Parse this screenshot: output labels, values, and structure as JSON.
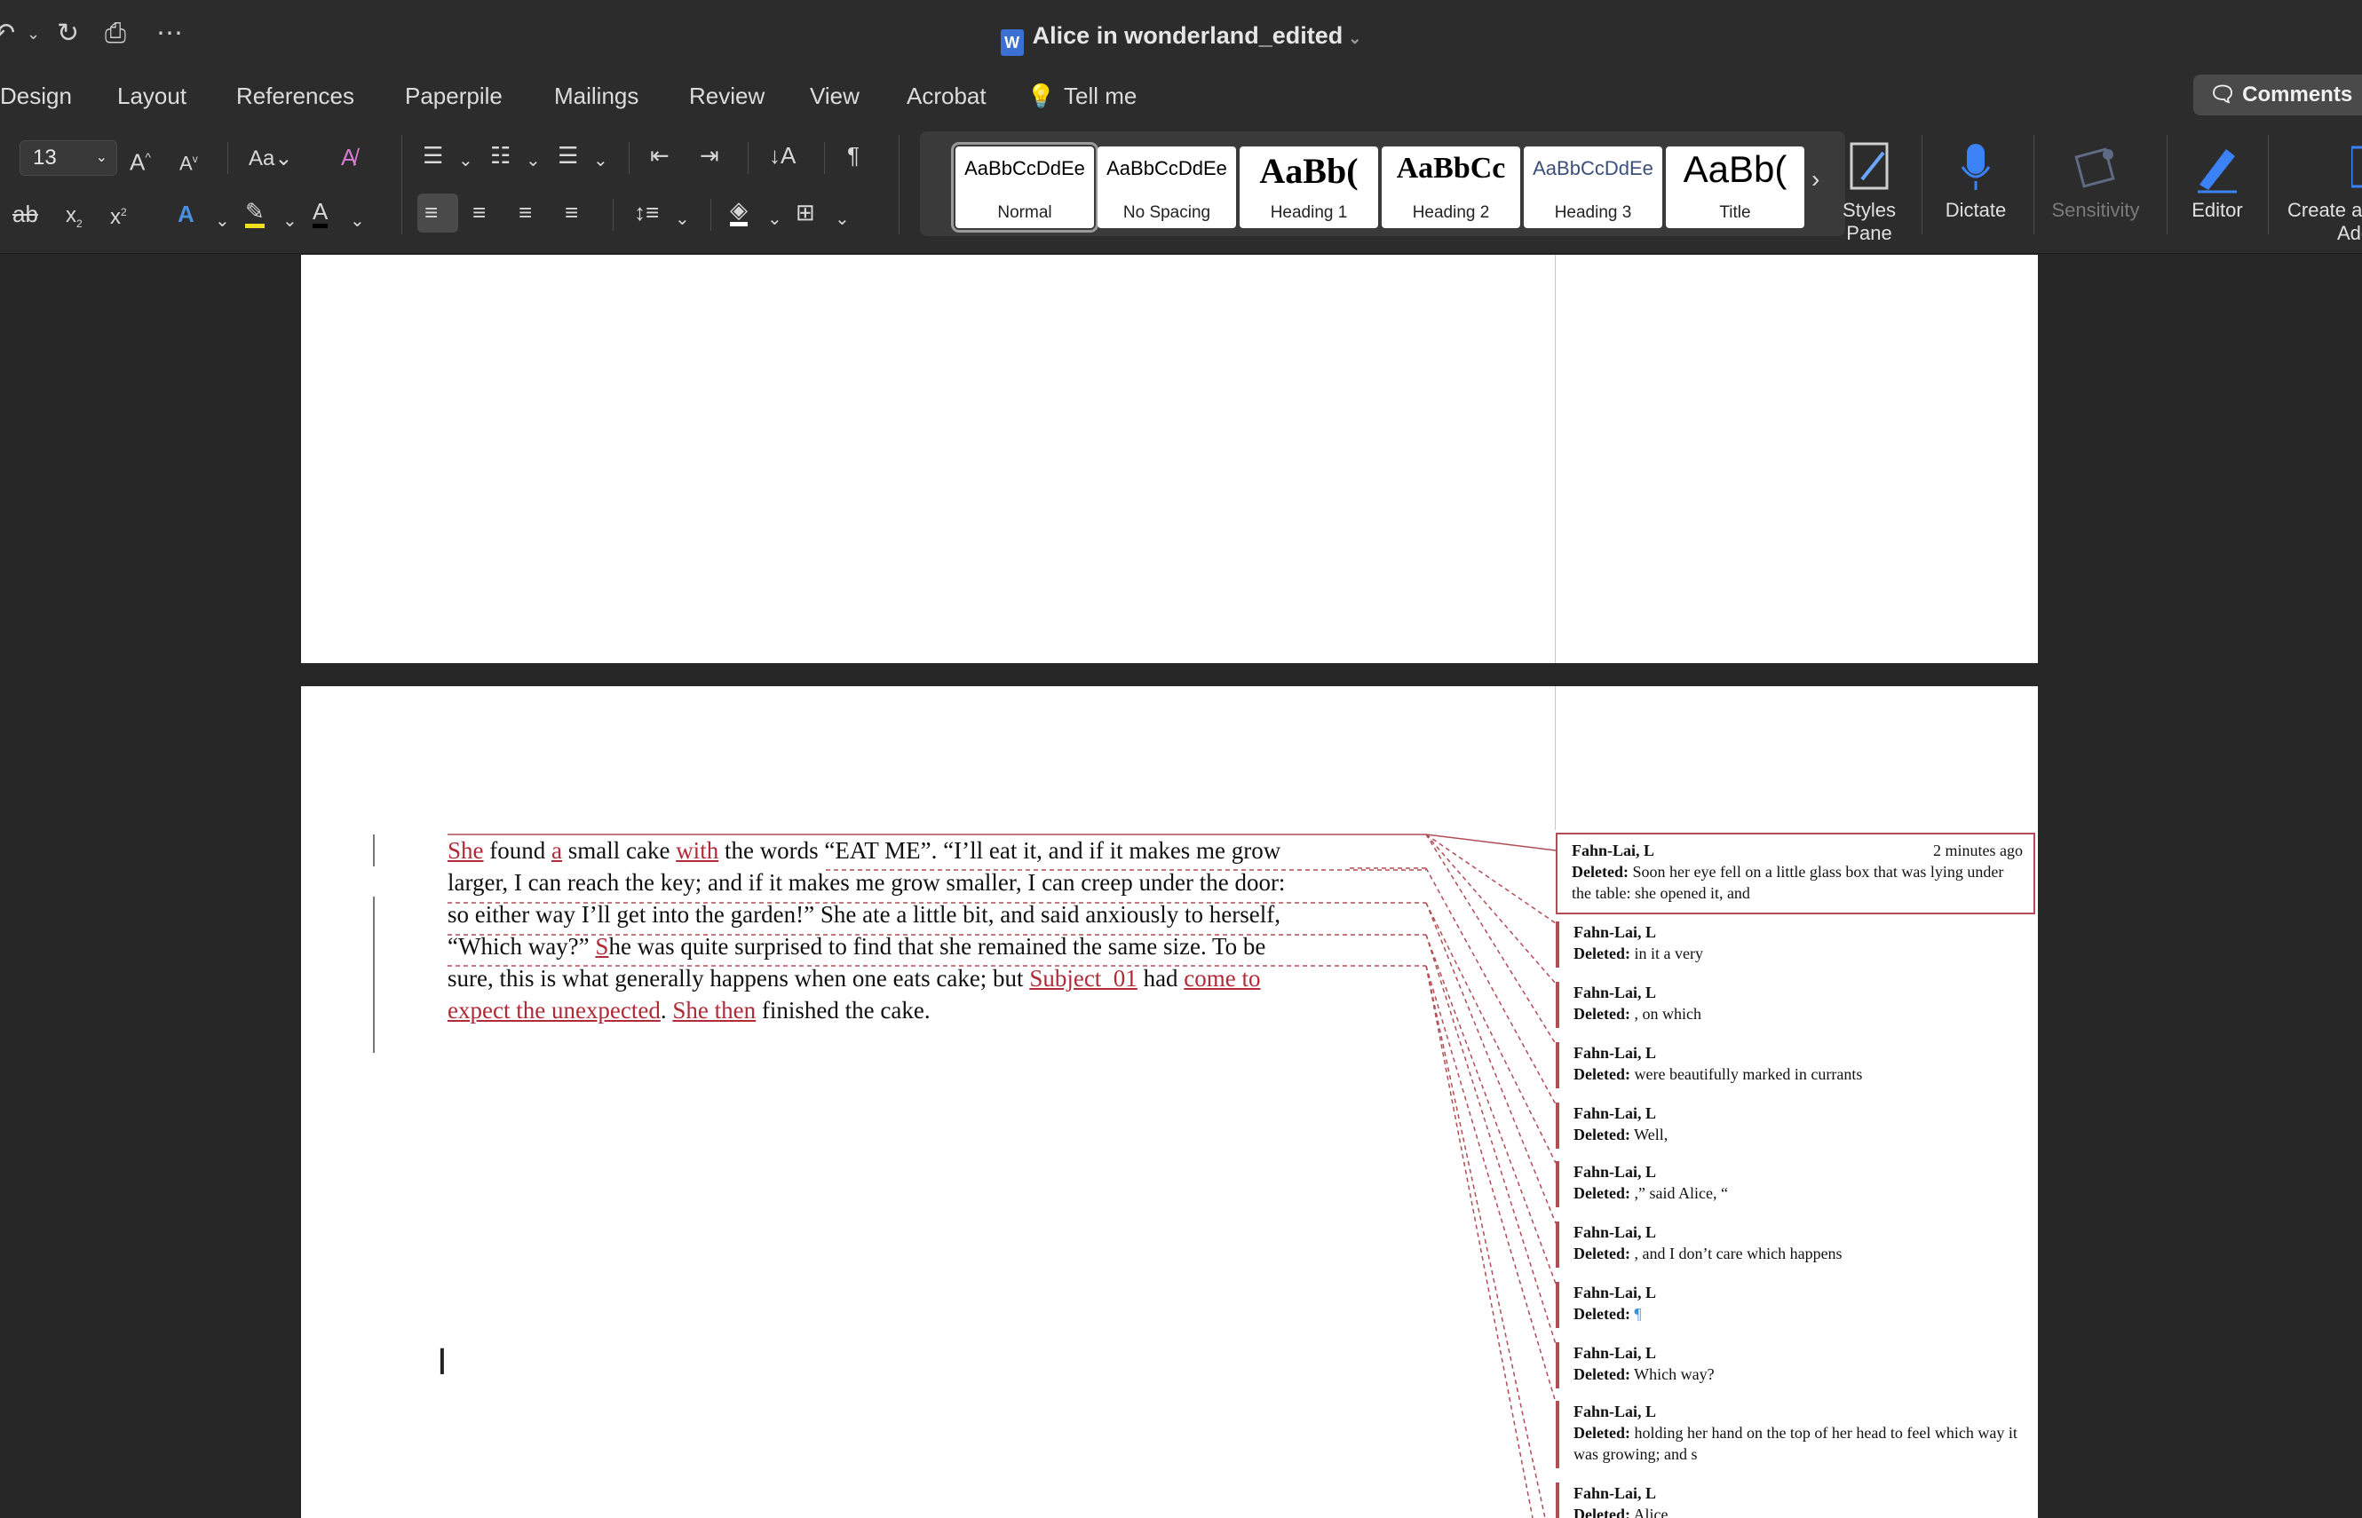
{
  "window": {
    "title": "Alice in wonderland_edited",
    "toolbar_icons": [
      "undo-icon",
      "chevron-down-icon",
      "redo-icon",
      "print-icon",
      "more-icon"
    ]
  },
  "menu": {
    "tabs": [
      "Design",
      "Layout",
      "References",
      "Paperpile",
      "Mailings",
      "Review",
      "View",
      "Acrobat",
      "Tell me"
    ],
    "comments_label": "Comments"
  },
  "ribbon": {
    "font_size": "13",
    "styles": [
      {
        "sample": "AaBbCcDdEe",
        "name": "Normal",
        "selected": true
      },
      {
        "sample": "AaBbCcDdEe",
        "name": "No Spacing",
        "selected": false
      },
      {
        "sample": "AaBb(",
        "name": "Heading 1",
        "selected": false
      },
      {
        "sample": "AaBbCc",
        "name": "Heading 2",
        "selected": false
      },
      {
        "sample": "AaBbCcDdEe",
        "name": "Heading 3",
        "selected": false
      },
      {
        "sample": "AaBb(",
        "name": "Title",
        "selected": false
      }
    ],
    "styles_pane": [
      "Styles",
      "Pane"
    ],
    "dictate": "Dictate",
    "sensitivity": "Sensitivity",
    "editor": "Editor",
    "create_adobe": [
      "Create a",
      "Adob"
    ],
    "accent_color": "#3b6fd1"
  },
  "document": {
    "lines": [
      {
        "parts": [
          {
            "t": "She",
            "ins": true
          },
          {
            "t": " found "
          },
          {
            "t": "a",
            "ins": true
          },
          {
            "t": " small cake "
          },
          {
            "t": "with",
            "ins": true
          },
          {
            "t": " the words “EAT ME”. “I’ll eat it, and if it makes me grow"
          }
        ]
      },
      {
        "parts": [
          {
            "t": "larger, I can reach the key; and if it makes me grow smaller, I can creep under the door:"
          }
        ]
      },
      {
        "parts": [
          {
            "t": "so either way I’ll get into the garden!” She ate a little bit, and said anxiously to herself,"
          }
        ]
      },
      {
        "parts": [
          {
            "t": "“Which way?” "
          },
          {
            "t": "S",
            "ins": true
          },
          {
            "t": "he was quite surprised to find that she remained the same size. To be"
          }
        ]
      },
      {
        "parts": [
          {
            "t": "sure, this is what generally happens when one eats cake; but "
          },
          {
            "t": "Subject_01",
            "ins": true
          },
          {
            "t": " had "
          },
          {
            "t": "come to",
            "ins": true
          }
        ]
      },
      {
        "parts": [
          {
            "t": "expect the unexpected",
            "ins": true
          },
          {
            "t": ". "
          },
          {
            "t": "She then",
            "ins": true
          },
          {
            "t": " finished the cake."
          }
        ]
      }
    ],
    "comments": [
      {
        "author": "Fahn-Lai, L",
        "time": "2 minutes ago",
        "label": "Deleted:",
        "text": "Soon her eye fell on a little glass box that was lying under the table: she opened it, and"
      },
      {
        "author": "Fahn-Lai, L",
        "label": "Deleted:",
        "text": "in it a very"
      },
      {
        "author": "Fahn-Lai, L",
        "label": "Deleted:",
        "text": ", on which"
      },
      {
        "author": "Fahn-Lai, L",
        "label": "Deleted:",
        "text": " were beautifully marked in currants"
      },
      {
        "author": "Fahn-Lai, L",
        "label": "Deleted:",
        "text": "Well,"
      },
      {
        "author": "Fahn-Lai, L",
        "label": "Deleted:",
        "text": ",” said Alice, “"
      },
      {
        "author": "Fahn-Lai, L",
        "label": "Deleted:",
        "text": ", and I don’t care which happens"
      },
      {
        "author": "Fahn-Lai, L",
        "label": "Deleted:",
        "text": "¶"
      },
      {
        "author": "Fahn-Lai, L",
        "label": "Deleted:",
        "text": " Which way?"
      },
      {
        "author": "Fahn-Lai, L",
        "label": "Deleted:",
        "text": "holding her hand on the top of her head to feel which way it was growing; and s"
      },
      {
        "author": "Fahn-Lai, L",
        "label": "Deleted:",
        "text": "Alice"
      }
    ],
    "revision_color": "#b02a37"
  }
}
